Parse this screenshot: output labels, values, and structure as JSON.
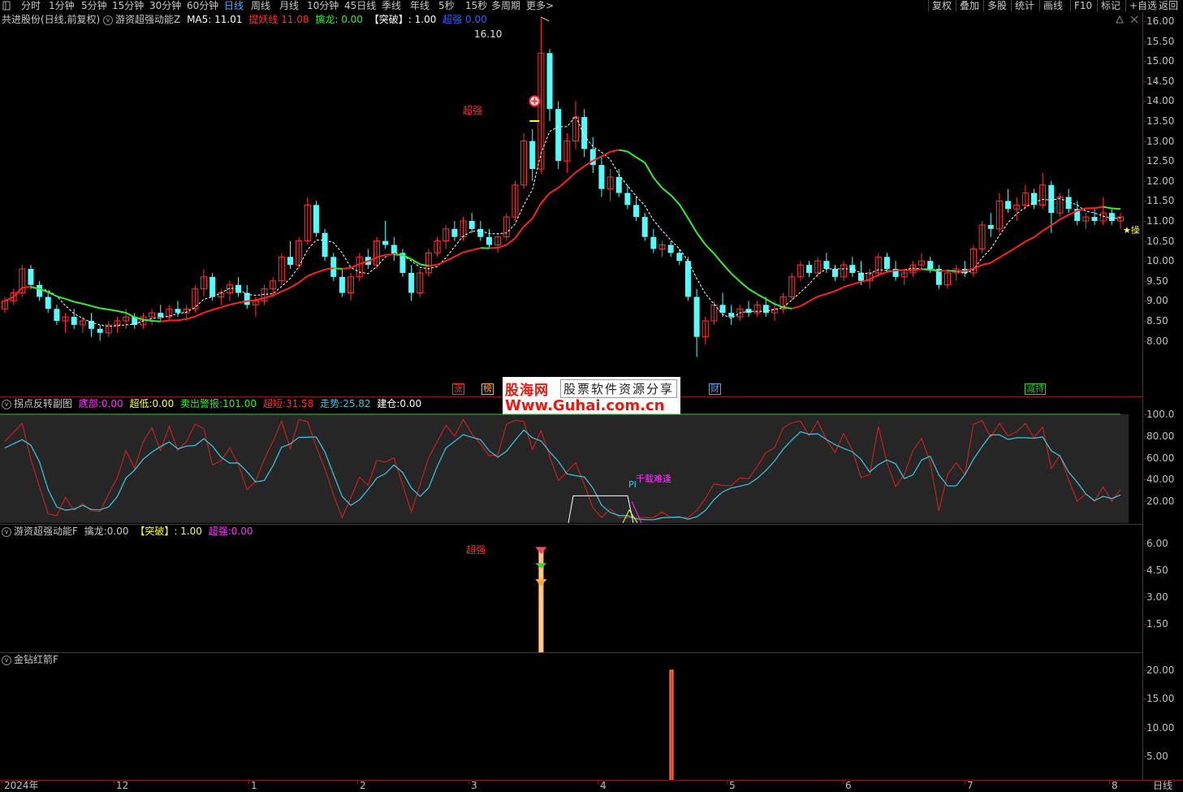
{
  "topbar": {
    "periods": [
      "分时",
      "1分钟",
      "5分钟",
      "15分钟",
      "30分钟",
      "60分钟",
      "日线",
      "周线",
      "月线",
      "10分钟",
      "45日线",
      "季线",
      "年线",
      "5秒",
      "15秒",
      "多周期",
      "更多>"
    ],
    "active_period": "日线",
    "right_buttons": [
      "复权",
      "叠加",
      "多股",
      "统计",
      "画线",
      "F10",
      "标记",
      "+自选",
      "返回"
    ]
  },
  "main_panel": {
    "stock": "共进股份(日线,前复权)",
    "indicator": "游资超强动能Z",
    "ma5_label": "MA5: 11.01",
    "tiyao_label": "提妖线",
    "tiyao_value": "11.08",
    "qinlong_label": "擒龙: 0.00",
    "tupo_label": "【突破】: 1.00",
    "chaoqiang_label": "超强",
    "chaoqiang_value": "0.00",
    "peak_label": "16.10",
    "chaoqiang_tag": "超强",
    "current_tag": "★操",
    "markers": [
      {
        "text": "涨",
        "color": "#ff3333"
      },
      {
        "text": "榜",
        "color": "#ffaa33"
      },
      {
        "text": "财",
        "color": "#4da6ff"
      },
      {
        "text": "减持",
        "color": "#33cc33"
      }
    ],
    "axis": [
      "16.00",
      "15.50",
      "15.00",
      "14.50",
      "14.00",
      "13.50",
      "13.00",
      "12.50",
      "12.00",
      "11.50",
      "11.00",
      "10.50",
      "10.00",
      "9.50",
      "9.00",
      "8.50",
      "8.00"
    ]
  },
  "watermark": {
    "brand": "股海网",
    "slogan": "股票软件资源分享",
    "url": "Www.Guhai.com.cn"
  },
  "sub1": {
    "title": "拐点反转副图",
    "dibu_label": "底部:",
    "dibu_value": "0.00",
    "chaodi_label": "超低:",
    "chaodi_value": "0.00",
    "sell_label": "卖出警报:",
    "sell_value": "101.00",
    "chaoduan_label": "超短:",
    "chaoduan_value": "31.58",
    "trend_label": "走势:",
    "trend_value": "25.82",
    "build_label": "建仓:",
    "build_value": "0.00",
    "pi_label": "PI",
    "qianzai_label": "千载难逢",
    "axis": [
      "100.0",
      "80.00",
      "60.00",
      "40.00",
      "20.00"
    ]
  },
  "sub2": {
    "title": "游资超强动能F",
    "qinlong_label": "擒龙:",
    "qinlong_value": "0.00",
    "tupo_label": "【突破】: 1.00",
    "chaoqiang_label": "超强:",
    "chaoqiang_value": "0.00",
    "signal_tag": "超强",
    "axis": [
      "6.00",
      "4.50",
      "3.00",
      "1.50"
    ]
  },
  "sub3": {
    "title": "金钻红箭F",
    "axis": [
      "20.00",
      "15.00",
      "10.00",
      "5.00"
    ]
  },
  "datebar": {
    "labels": [
      "2024年",
      "12",
      "1",
      "2",
      "3",
      "4",
      "5",
      "6",
      "7",
      "8"
    ],
    "period": "日线"
  },
  "colors": {
    "up": "#ff3333",
    "down": "#54fcfc",
    "red_line": "#ff2020",
    "green_line": "#33ee33",
    "white_line": "#ffffff",
    "sub1_cyan": "#3ec6e0",
    "sub1_red": "#e0201e",
    "axis_border": "#8b1a1a"
  },
  "chart_data": {
    "type": "candlestick",
    "title": "",
    "ylim": [
      7.3,
      16.5
    ],
    "candles": [
      [
        8.8,
        9.1,
        8.7,
        9.0
      ],
      [
        9.0,
        9.3,
        8.9,
        9.2
      ],
      [
        9.2,
        9.9,
        9.1,
        9.8
      ],
      [
        9.8,
        9.9,
        9.3,
        9.4
      ],
      [
        9.4,
        9.5,
        9.0,
        9.1
      ],
      [
        9.1,
        9.2,
        8.7,
        8.8
      ],
      [
        8.8,
        8.9,
        8.4,
        8.5
      ],
      [
        8.5,
        8.7,
        8.2,
        8.6
      ],
      [
        8.6,
        8.8,
        8.3,
        8.4
      ],
      [
        8.4,
        8.6,
        8.2,
        8.5
      ],
      [
        8.5,
        8.7,
        8.1,
        8.3
      ],
      [
        8.3,
        8.4,
        8.0,
        8.2
      ],
      [
        8.2,
        8.5,
        8.1,
        8.4
      ],
      [
        8.4,
        8.6,
        8.2,
        8.5
      ],
      [
        8.5,
        8.8,
        8.3,
        8.6
      ],
      [
        8.6,
        8.7,
        8.3,
        8.4
      ],
      [
        8.4,
        8.7,
        8.3,
        8.6
      ],
      [
        8.6,
        8.8,
        8.4,
        8.7
      ],
      [
        8.7,
        8.9,
        8.5,
        8.6
      ],
      [
        8.6,
        8.9,
        8.5,
        8.8
      ],
      [
        8.8,
        9.0,
        8.6,
        8.7
      ],
      [
        8.7,
        8.9,
        8.5,
        8.8
      ],
      [
        8.8,
        9.4,
        8.7,
        9.3
      ],
      [
        9.3,
        9.8,
        9.1,
        9.6
      ],
      [
        9.6,
        9.7,
        9.0,
        9.1
      ],
      [
        9.1,
        9.3,
        8.9,
        9.2
      ],
      [
        9.2,
        9.5,
        9.0,
        9.4
      ],
      [
        9.4,
        9.6,
        9.1,
        9.2
      ],
      [
        9.2,
        9.4,
        8.8,
        8.9
      ],
      [
        8.9,
        9.1,
        8.6,
        9.0
      ],
      [
        9.0,
        9.4,
        8.9,
        9.3
      ],
      [
        9.3,
        9.6,
        9.1,
        9.5
      ],
      [
        9.5,
        10.2,
        9.4,
        10.1
      ],
      [
        10.1,
        10.5,
        9.8,
        9.9
      ],
      [
        9.9,
        10.6,
        9.8,
        10.5
      ],
      [
        10.5,
        11.6,
        10.4,
        11.4
      ],
      [
        11.4,
        11.5,
        10.6,
        10.7
      ],
      [
        10.7,
        10.8,
        10.0,
        10.1
      ],
      [
        10.1,
        10.2,
        9.5,
        9.6
      ],
      [
        9.6,
        9.8,
        9.1,
        9.2
      ],
      [
        9.2,
        9.7,
        9.0,
        9.6
      ],
      [
        9.6,
        10.2,
        9.5,
        10.1
      ],
      [
        10.1,
        10.3,
        9.8,
        9.9
      ],
      [
        9.9,
        10.6,
        9.8,
        10.5
      ],
      [
        10.5,
        11.0,
        10.3,
        10.4
      ],
      [
        10.4,
        10.6,
        10.0,
        10.2
      ],
      [
        10.2,
        10.3,
        9.6,
        9.7
      ],
      [
        9.7,
        9.9,
        9.0,
        9.2
      ],
      [
        9.2,
        9.8,
        9.1,
        9.7
      ],
      [
        9.7,
        10.3,
        9.6,
        10.2
      ],
      [
        10.2,
        10.6,
        10.1,
        10.5
      ],
      [
        10.5,
        10.9,
        10.3,
        10.8
      ],
      [
        10.8,
        11.0,
        10.5,
        10.6
      ],
      [
        10.6,
        11.1,
        10.5,
        11.0
      ],
      [
        11.0,
        11.2,
        10.7,
        10.8
      ],
      [
        10.8,
        11.0,
        10.5,
        10.6
      ],
      [
        10.6,
        10.8,
        10.3,
        10.4
      ],
      [
        10.4,
        10.7,
        10.2,
        10.6
      ],
      [
        10.6,
        11.2,
        10.5,
        11.1
      ],
      [
        11.1,
        12.0,
        11.0,
        11.9
      ],
      [
        11.9,
        13.2,
        11.8,
        13.0
      ],
      [
        13.0,
        13.3,
        12.0,
        12.3
      ],
      [
        12.3,
        16.1,
        12.2,
        15.2
      ],
      [
        15.2,
        15.3,
        13.5,
        13.8
      ],
      [
        13.8,
        14.0,
        12.3,
        12.5
      ],
      [
        12.5,
        13.2,
        12.2,
        13.0
      ],
      [
        13.0,
        14.0,
        12.8,
        13.6
      ],
      [
        13.6,
        13.8,
        12.6,
        12.8
      ],
      [
        12.8,
        13.1,
        12.2,
        12.4
      ],
      [
        12.4,
        12.6,
        11.6,
        11.8
      ],
      [
        11.8,
        12.3,
        11.5,
        12.1
      ],
      [
        12.1,
        12.3,
        11.6,
        11.7
      ],
      [
        11.7,
        11.9,
        11.3,
        11.4
      ],
      [
        11.4,
        11.6,
        11.0,
        11.1
      ],
      [
        11.1,
        11.2,
        10.5,
        10.6
      ],
      [
        10.6,
        10.8,
        10.2,
        10.3
      ],
      [
        10.3,
        10.5,
        10.1,
        10.4
      ],
      [
        10.4,
        10.5,
        10.1,
        10.2
      ],
      [
        10.2,
        10.3,
        9.9,
        10.0
      ],
      [
        10.0,
        10.1,
        9.0,
        9.1
      ],
      [
        9.1,
        9.3,
        7.6,
        8.1
      ],
      [
        8.1,
        8.6,
        7.9,
        8.5
      ],
      [
        8.5,
        9.0,
        8.4,
        8.9
      ],
      [
        8.9,
        9.2,
        8.6,
        8.7
      ],
      [
        8.7,
        8.9,
        8.4,
        8.6
      ],
      [
        8.6,
        8.9,
        8.5,
        8.8
      ],
      [
        8.8,
        9.0,
        8.6,
        8.7
      ],
      [
        8.7,
        9.0,
        8.6,
        8.9
      ],
      [
        8.9,
        9.1,
        8.6,
        8.7
      ],
      [
        8.7,
        9.0,
        8.5,
        8.8
      ],
      [
        8.8,
        9.2,
        8.7,
        9.1
      ],
      [
        9.1,
        9.7,
        9.0,
        9.6
      ],
      [
        9.6,
        10.0,
        9.5,
        9.9
      ],
      [
        9.9,
        10.0,
        9.6,
        9.7
      ],
      [
        9.7,
        10.1,
        9.6,
        10.0
      ],
      [
        10.0,
        10.2,
        9.7,
        9.8
      ],
      [
        9.8,
        9.9,
        9.5,
        9.6
      ],
      [
        9.6,
        10.0,
        9.5,
        9.9
      ],
      [
        9.9,
        10.1,
        9.6,
        9.7
      ],
      [
        9.7,
        10.0,
        9.4,
        9.5
      ],
      [
        9.5,
        9.8,
        9.3,
        9.7
      ],
      [
        9.7,
        10.2,
        9.6,
        10.1
      ],
      [
        10.1,
        10.2,
        9.7,
        9.8
      ],
      [
        9.8,
        10.0,
        9.5,
        9.6
      ],
      [
        9.6,
        9.8,
        9.4,
        9.7
      ],
      [
        9.7,
        10.0,
        9.6,
        9.9
      ],
      [
        9.9,
        10.2,
        9.8,
        10.0
      ],
      [
        10.0,
        10.1,
        9.7,
        9.8
      ],
      [
        9.8,
        9.9,
        9.3,
        9.4
      ],
      [
        9.4,
        9.8,
        9.3,
        9.7
      ],
      [
        9.7,
        9.9,
        9.5,
        9.8
      ],
      [
        9.8,
        10.0,
        9.6,
        9.7
      ],
      [
        9.7,
        10.4,
        9.6,
        10.3
      ],
      [
        10.3,
        11.0,
        10.2,
        10.9
      ],
      [
        10.9,
        11.2,
        10.6,
        10.8
      ],
      [
        10.8,
        11.7,
        10.7,
        11.5
      ],
      [
        11.5,
        11.8,
        11.2,
        11.3
      ],
      [
        11.3,
        11.6,
        11.0,
        11.4
      ],
      [
        11.4,
        11.9,
        11.3,
        11.7
      ],
      [
        11.7,
        11.8,
        11.3,
        11.4
      ],
      [
        11.4,
        12.2,
        11.3,
        11.9
      ],
      [
        11.9,
        12.0,
        10.7,
        11.2
      ],
      [
        11.2,
        11.7,
        11.1,
        11.6
      ],
      [
        11.6,
        11.8,
        11.2,
        11.3
      ],
      [
        11.3,
        11.5,
        10.9,
        11.0
      ],
      [
        11.0,
        11.2,
        10.8,
        11.1
      ],
      [
        11.1,
        11.3,
        10.9,
        11.0
      ],
      [
        11.0,
        11.6,
        10.9,
        11.2
      ],
      [
        11.2,
        11.3,
        10.9,
        11.0
      ],
      [
        11.0,
        11.2,
        10.8,
        11.1
      ]
    ],
    "series_labels": [
      "MA5",
      "提妖线"
    ]
  }
}
